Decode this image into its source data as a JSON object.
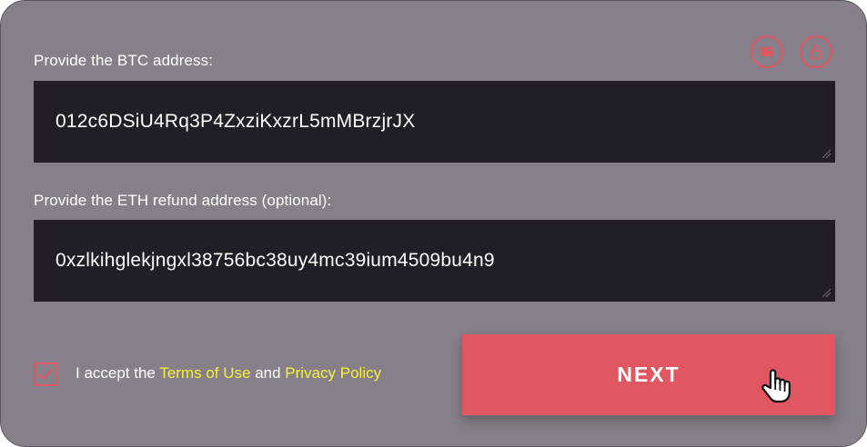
{
  "form": {
    "btc_label": "Provide the BTC address:",
    "btc_value": "012c6DSiU4Rq3P4ZxziKxzrL5mMBrzjrJX",
    "eth_label": "Provide the ETH refund address (optional):",
    "eth_value": "0xzlkihglekjngxl38756bc38uy4mc39ium4509bu4n9",
    "accept_prefix": "I accept the",
    "terms_link": "Terms of Use",
    "and_text": "and",
    "privacy_link": "Privacy Policy",
    "terms_checked": true,
    "next_label": "NEXT"
  },
  "header_icons": [
    "card-icon",
    "lock-icon"
  ],
  "colors": {
    "card_bg": "#877f89",
    "field_bg": "#221d27",
    "accent": "#e05661",
    "link": "#f4f13a",
    "text": "#ffffff"
  }
}
